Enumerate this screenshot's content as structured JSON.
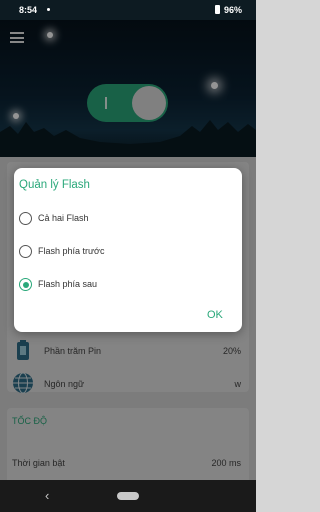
{
  "status_bar": {
    "time": "8:54",
    "battery": "96%"
  },
  "hero": {
    "toggle_on": true
  },
  "settings": {
    "battery_label": "Phần trăm Pin",
    "battery_value": "20%",
    "language_label": "Ngôn ngữ",
    "language_value": "w",
    "speed_section": "TỐC ĐỘ",
    "time_label": "Thời gian bật",
    "time_value": "200 ms"
  },
  "dialog": {
    "title": "Quản lý Flash",
    "options": [
      {
        "label": "Cả hai Flash",
        "selected": false
      },
      {
        "label": "Flash phía trước",
        "selected": false
      },
      {
        "label": "Flash phía sau",
        "selected": true
      }
    ],
    "ok_label": "OK"
  },
  "colors": {
    "accent": "#2aa87a"
  },
  "icons": [
    "menu-icon",
    "battery-status-icon",
    "battery-settings-icon",
    "globe-icon",
    "back-icon",
    "home-icon"
  ]
}
